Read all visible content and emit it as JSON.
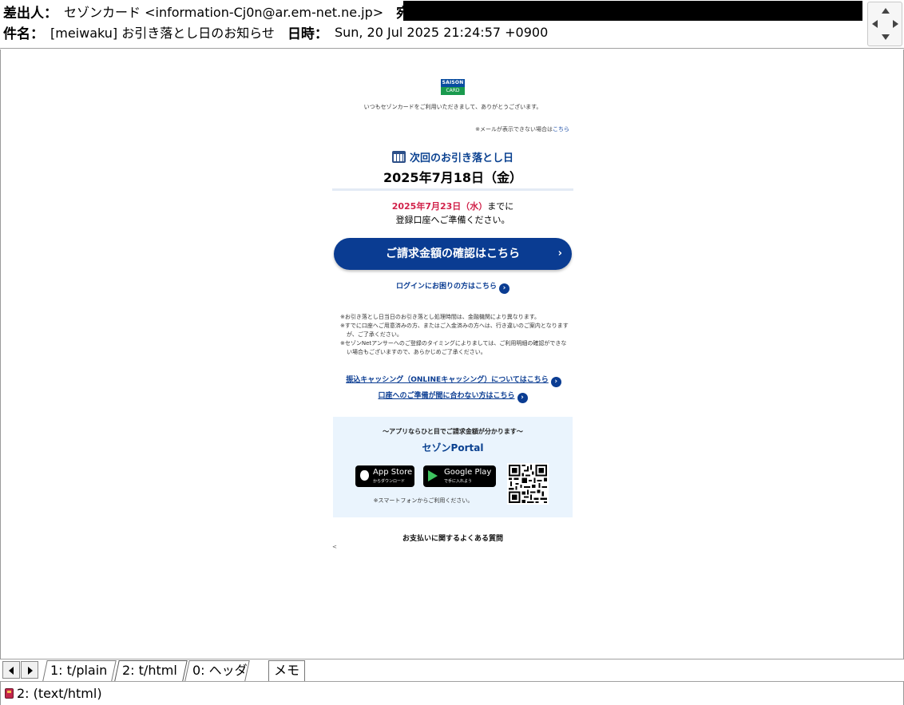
{
  "header": {
    "from_label": "差出人：",
    "from_value": "セゾンカード <information-Cj0n@ar.em-net.ne.jp>",
    "to_label": "宛先：",
    "subject_label": "件名：",
    "subject_value": "[meiwaku] お引き落とし日のお知らせ",
    "date_label": "日時：",
    "date_value": "Sun, 20 Jul 2025 21:24:57 +0900"
  },
  "mail": {
    "logo_top": "SAISON",
    "logo_bottom": "CARD",
    "greeting": "いつもセゾンカードをご利用いただきまして、ありがとうございます。",
    "view_note": "※メールが表示できない場合は",
    "view_note_link": "こちら",
    "next_title": "次回のお引き落とし日",
    "next_date": "2025年7月18日（金）",
    "deadline_date": "2025年7月23日（水）",
    "deadline_suffix": "までに",
    "deadline_line2": "登録口座へご準備ください。",
    "bill_button": "ご請求金額の確認はこちら",
    "bill_chevron": "›",
    "login_link": "ログインにお困りの方はこちら",
    "notes": [
      "※お引き落とし日当日のお引き落とし処理時間は、金融機関により異なります。",
      "※すでに口座へご用意済みの方、またはご入金済みの方へは、行き違いのご案内となりますが、ご了承ください。",
      "※セゾンNetアンサーへのご登録のタイミングによりましては、ご利用明細の確認ができない場合もございますので、あらかじめご了承ください。"
    ],
    "cashing_link": "振込キャッシング（ONLINEキャッシング）についてはこちら",
    "account_link": "口座へのご準備が間に合わない方はこちら",
    "link_arrow": "›",
    "portal": {
      "title": "～アプリならひと目でご請求金額が分かります～",
      "name": "セゾンPortal",
      "appstore_big": "App Store",
      "appstore_small": "からダウンロード",
      "gplay_big": "Google Play",
      "gplay_small": "で手に入れよう",
      "note": "※スマートフォンからご利用ください。"
    },
    "faq": "お支払いに関するよくある質問",
    "tiny": "<"
  },
  "tabs": [
    {
      "label": "1: t/plain"
    },
    {
      "label": "2: t/html"
    },
    {
      "label": "0: ヘッダ"
    },
    {
      "label": "メモ"
    }
  ],
  "status": {
    "text": "2: (text/html)"
  }
}
